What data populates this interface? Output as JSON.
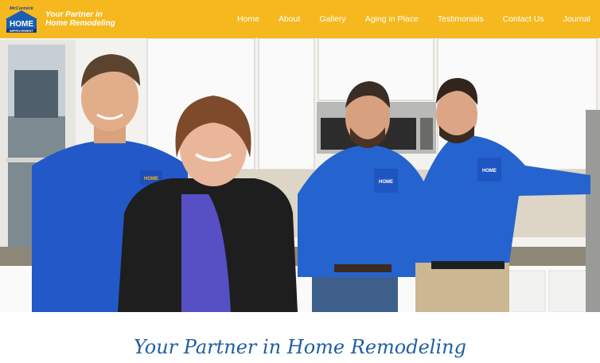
{
  "header": {
    "logo": {
      "top_text": "McCormick",
      "main_text": "HOME",
      "sub_text": "IMPROVEMENT"
    },
    "tagline_line1": "Your Partner in",
    "tagline_line2": "Home Remodeling",
    "background_color": "#f5b81f"
  },
  "nav": {
    "items": [
      {
        "label": "Home"
      },
      {
        "label": "About"
      },
      {
        "label": "Gallery"
      },
      {
        "label": "Aging in Place"
      },
      {
        "label": "Testimonials"
      },
      {
        "label": "Contact Us"
      },
      {
        "label": "Journal"
      }
    ]
  },
  "hero": {
    "shirt_badge": "HOME"
  },
  "main": {
    "heading": "Your Partner in Home Remodeling",
    "heading_color": "#1f5fa3"
  }
}
